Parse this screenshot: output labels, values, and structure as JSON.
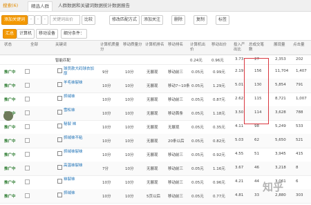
{
  "tabs": [
    "搜索(6)",
    "精选人群",
    "人群数据和关键词数据统计数据报告"
  ],
  "toolbar": {
    "add": "添加关键词",
    "a": "·",
    "b": "·",
    "c": "·",
    "search_placeholder": "关键词出价",
    "cmp": "比较",
    "batch": "修改匹配方式",
    "watch": "添加关注",
    "del": "删除",
    "copy": "复制",
    "tag": "标签"
  },
  "filter": {
    "summary": "汇总",
    "device": "计算机",
    "mobile": "移动设备",
    "cond": "细分条件："
  },
  "headers": [
    "状态",
    "全部",
    "关键词",
    "计算机质量分",
    "移动质量分",
    "计算机排名",
    "移动排名",
    "计算机出价",
    "移动出价",
    "投入产出比",
    "总成交笔数",
    "展现量",
    "点击量"
  ],
  "smart_match": {
    "label": "智能匹配",
    "pc_bid": "0.24元",
    "m_bid": "0.96元",
    "roi": "3.73",
    "deals": "27",
    "impr": "2,353",
    "clicks": "202"
  },
  "rows": [
    {
      "status": "推广中",
      "kw": "球员款大码球衣加厚",
      "pcq": "9分",
      "mq": "10分",
      "pcr": "无展现",
      "mr": "移动前三",
      "pcb": "0.05元",
      "mb": "0.99元",
      "roi": "2.19",
      "deals": "156",
      "impr": "11,704",
      "clicks": "1,407"
    },
    {
      "status": "推广中",
      "kw": "羊毛袜裂袜",
      "pcq": "10分",
      "mq": "10分",
      "pcr": "无展现",
      "mr": "移动7~10条",
      "pcb": "0.05元",
      "mb": "1.29元",
      "roi": "5.01",
      "deals": "130",
      "impr": "5,854",
      "clicks": "791"
    },
    {
      "status": "推广中",
      "kw": "抓绒袜",
      "pcq": "10分",
      "mq": "10分",
      "pcr": "无展现",
      "mr": "移动前三",
      "pcb": "0.05元",
      "mb": "0.87元",
      "roi": "2.62",
      "deals": "115",
      "impr": "8,721",
      "clicks": "1,007"
    },
    {
      "status": "推广中",
      "kw": "雪松袜",
      "pcq": "10分",
      "mq": "10分",
      "pcr": "无展现",
      "mr": "移动首条",
      "pcb": "0.05元",
      "mb": "1.18元",
      "roi": "3.50",
      "deals": "114",
      "impr": "3,628",
      "clicks": "788"
    },
    {
      "status": "推广中",
      "kw": "秘裂 袜",
      "pcq": "10分",
      "mq": "10分",
      "pcr": "无展现",
      "mr": "无展现",
      "pcb": "0.05元",
      "mb": "0.35元",
      "roi": "4.11",
      "deals": "98",
      "impr": "5,249",
      "clicks": "533"
    },
    {
      "status": "推广中",
      "kw": "抓绒袜不粘",
      "pcq": "10分",
      "mq": "10分",
      "pcr": "无展现",
      "mr": "20条以后",
      "pcb": "0.05元",
      "mb": "0.82元",
      "roi": "5.03",
      "deals": "62",
      "impr": "5,650",
      "clicks": "521"
    },
    {
      "status": "推广中",
      "kw": "抓绒袜裂袜",
      "pcq": "10分",
      "mq": "10分",
      "pcr": "无展现",
      "mr": "移动前三",
      "pcb": "0.05元",
      "mb": "0.92元",
      "roi": "4.55",
      "deals": "51",
      "impr": "3,945",
      "clicks": "415"
    },
    {
      "status": "推广中",
      "kw": "高温袜裂袜",
      "pcq": "7分",
      "mq": "10分",
      "pcr": "无展现",
      "mr": "移动前三",
      "pcb": "0.05元",
      "mb": "1.16元",
      "roi": "3.67",
      "deals": "46",
      "impr": "3,218",
      "clicks": "8"
    },
    {
      "status": "推广中",
      "kw": "袜裂袜",
      "pcq": "10分",
      "mq": "10分",
      "pcr": "无展现",
      "mr": "移动前三",
      "pcb": "0.05元",
      "mb": "0.96元",
      "roi": "4.21",
      "deals": "44",
      "impr": "3,061",
      "clicks": "6"
    },
    {
      "status": "推广中",
      "kw": "抓绒袜",
      "pcq": "10分",
      "mq": "10分",
      "pcr": "5页以后",
      "mr": "移动前三",
      "pcb": "0.05元",
      "mb": "0.77元",
      "roi": "4.81",
      "deals": "33",
      "impr": "2,880",
      "clicks": "303"
    }
  ],
  "watermark": "知乎"
}
